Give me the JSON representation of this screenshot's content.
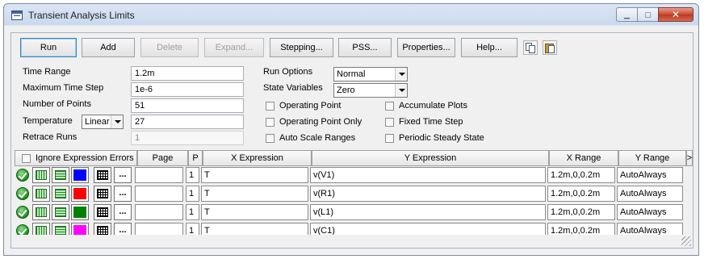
{
  "window": {
    "title": "Transient Analysis Limits"
  },
  "toolbar": {
    "run": "Run",
    "add": "Add",
    "delete": "Delete",
    "expand": "Expand...",
    "stepping": "Stepping...",
    "pss": "PSS...",
    "properties": "Properties...",
    "help": "Help...",
    "copy_icon": "copy-icon",
    "paste_icon": "paste-icon"
  },
  "params": {
    "time_range": {
      "label": "Time Range",
      "value": "1.2m"
    },
    "max_time_step": {
      "label": "Maximum Time Step",
      "value": "1e-6"
    },
    "num_points": {
      "label": "Number of Points",
      "value": "51"
    },
    "temperature": {
      "label": "Temperature",
      "mode": "Linear",
      "value": "27"
    },
    "retrace_runs": {
      "label": "Retrace Runs",
      "value": "1"
    }
  },
  "options": {
    "run_options": {
      "label": "Run Options",
      "value": "Normal"
    },
    "state_variables": {
      "label": "State Variables",
      "value": "Zero"
    },
    "checkboxes": {
      "operating_point": "Operating Point",
      "operating_point_only": "Operating Point Only",
      "auto_scale_ranges": "Auto Scale Ranges",
      "accumulate_plots": "Accumulate Plots",
      "fixed_time_step": "Fixed Time Step",
      "periodic_steady_state": "Periodic Steady State"
    }
  },
  "grid": {
    "ignore_errors": "Ignore Expression Errors",
    "headers": {
      "page": "Page",
      "p": "P",
      "x_expression": "X Expression",
      "y_expression": "Y Expression",
      "x_range": "X Range",
      "y_range": "Y Range",
      "more": ">"
    },
    "rows": [
      {
        "color": "#0000ff",
        "page": "",
        "p": "1",
        "x": "T",
        "y": "v(V1)",
        "x_range": "1.2m,0,0.2m",
        "y_range": "AutoAlways"
      },
      {
        "color": "#ff0000",
        "page": "",
        "p": "1",
        "x": "T",
        "y": "v(R1)",
        "x_range": "1.2m,0,0.2m",
        "y_range": "AutoAlways"
      },
      {
        "color": "#008000",
        "page": "",
        "p": "1",
        "x": "T",
        "y": "v(L1)",
        "x_range": "1.2m,0,0.2m",
        "y_range": "AutoAlways"
      },
      {
        "color": "#ff00ff",
        "page": "",
        "p": "1",
        "x": "T",
        "y": "v(C1)",
        "x_range": "1.2m,0,0.2m",
        "y_range": "AutoAlways"
      }
    ],
    "ellipsis": "..."
  }
}
